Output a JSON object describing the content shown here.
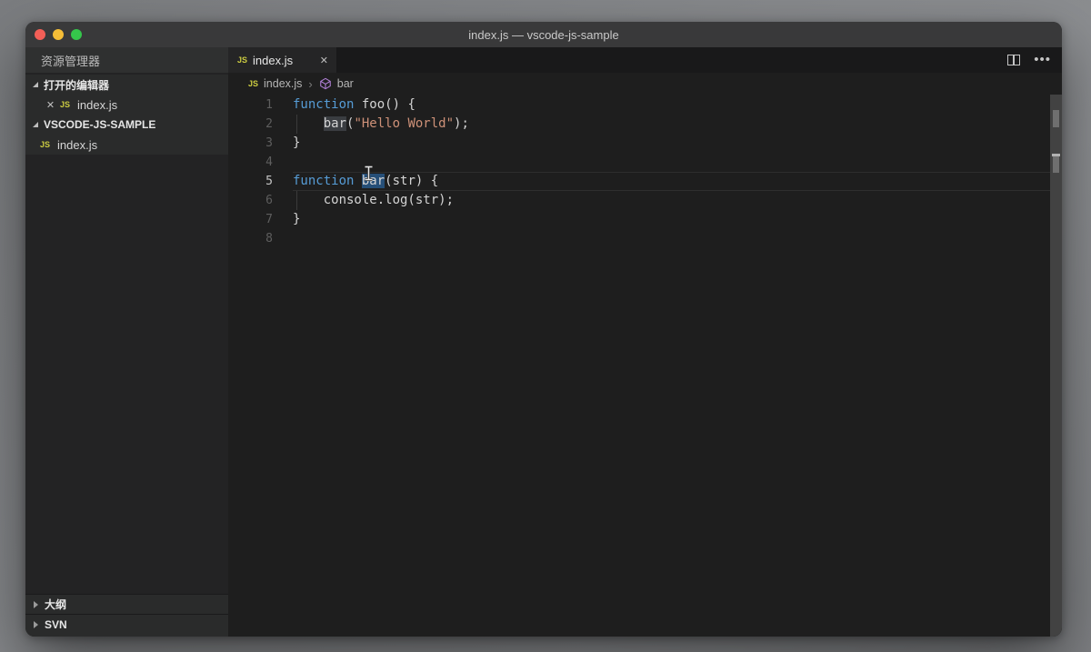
{
  "window": {
    "title": "index.js — vscode-js-sample",
    "traffic_lights": {
      "close": "#f35f57",
      "minimize": "#f5bd37",
      "zoom": "#35c64b"
    }
  },
  "sidebar": {
    "title": "资源管理器",
    "open_editors_section": {
      "label": "打开的编辑器",
      "expanded": true
    },
    "open_editor_file": {
      "name": "index.js",
      "icon": "JS",
      "close_glyph": "✕",
      "dirty": false
    },
    "folder_section": {
      "label": "VSCODE-JS-SAMPLE",
      "expanded": true
    },
    "tree_file": {
      "name": "index.js",
      "icon": "JS"
    },
    "bottom_sections": [
      {
        "label": "大纲",
        "expanded": false
      },
      {
        "label": "SVN",
        "expanded": false
      }
    ]
  },
  "tabbar": {
    "tabs": [
      {
        "label": "index.js",
        "icon": "JS",
        "active": true,
        "close_glyph": "✕"
      }
    ],
    "more_actions_glyph": "•••"
  },
  "breadcrumb": {
    "file": "index.js",
    "file_icon": "JS",
    "separator": "›",
    "symbol": "bar"
  },
  "editor": {
    "language": "javascript",
    "selection_word": "bar",
    "active_line": 5,
    "lines": [
      {
        "num": "1",
        "segments": [
          {
            "t": "kw",
            "s": "function"
          },
          {
            "t": "pl",
            "s": " foo() {"
          }
        ]
      },
      {
        "num": "2",
        "indent_guide": true,
        "segments": [
          {
            "t": "pl",
            "s": "    "
          },
          {
            "t": "hl",
            "s": "bar"
          },
          {
            "t": "pl",
            "s": "("
          },
          {
            "t": "str",
            "s": "\"Hello World\""
          },
          {
            "t": "pl",
            "s": ");"
          }
        ]
      },
      {
        "num": "3",
        "segments": [
          {
            "t": "pl",
            "s": "}"
          }
        ]
      },
      {
        "num": "4",
        "segments": []
      },
      {
        "num": "5",
        "active": true,
        "segments": [
          {
            "t": "kw",
            "s": "function"
          },
          {
            "t": "pl",
            "s": " "
          },
          {
            "t": "sel",
            "s": "bar"
          },
          {
            "t": "pl",
            "s": "(str) {"
          }
        ]
      },
      {
        "num": "6",
        "indent_guide": true,
        "segments": [
          {
            "t": "pl",
            "s": "    console.log(str);"
          }
        ]
      },
      {
        "num": "7",
        "segments": [
          {
            "t": "pl",
            "s": "}"
          }
        ]
      },
      {
        "num": "8",
        "segments": []
      }
    ]
  },
  "colors": {
    "keyword": "#569cd6",
    "string": "#ce9178",
    "plain_text": "#d4d4d4",
    "selection_bg": "#264f78",
    "word_highlight_bg": "#3a3d41",
    "editor_bg": "#1e1e1e",
    "sidebar_bg": "#232324",
    "titlebar_bg": "#39393a",
    "js_icon": "#cbcb41",
    "symbol_icon": "#b180d7"
  }
}
